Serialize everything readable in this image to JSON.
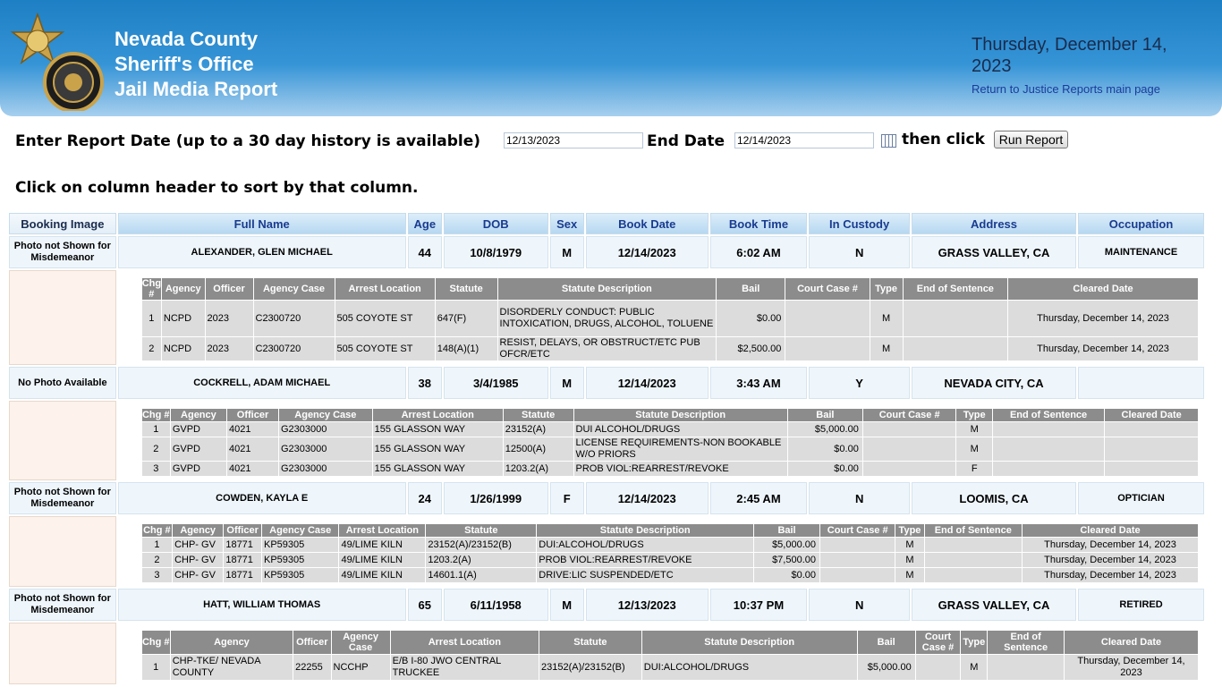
{
  "header": {
    "org_lines": [
      "Nevada County",
      "Sheriff's Office",
      "Jail Media Report"
    ],
    "date_text": "Thursday, December 14, 2023",
    "return_link": "Return to Justice Reports main page",
    "logo_icon": "sheriff-badge-seal"
  },
  "filter": {
    "report_date_label": "Enter Report Date (up to a 30 day history is available)",
    "start_date_value": "12/13/2023",
    "end_date_label": "End Date",
    "end_date_value": "12/14/2023",
    "then_click": "then click",
    "run_button": "Run Report",
    "calendar_icon": "calendar-icon"
  },
  "sort_hint": "Click on column header to sort by that column.",
  "columns": [
    "Booking Image",
    "Full Name",
    "Age",
    "DOB",
    "Sex",
    "Book Date",
    "Book Time",
    "In Custody",
    "Address",
    "Occupation"
  ],
  "bookings": [
    {
      "image": "Photo not Shown for Misdemeanor",
      "name": "ALEXANDER, GLEN MICHAEL",
      "age": "44",
      "dob": "10/8/1979",
      "sex": "M",
      "book_date": "12/14/2023",
      "book_time": "6:02 AM",
      "custody": "N",
      "address": "GRASS VALLEY, CA",
      "occupation": "MAINTENANCE",
      "charge_headers": [
        "Chg #",
        "Agency",
        "Officer",
        "Agency Case",
        "Arrest Location",
        "Statute",
        "Statute Description",
        "Bail",
        "Court Case #",
        "Type",
        "End of Sentence",
        "Cleared Date"
      ],
      "charges": [
        [
          "1",
          "NCPD",
          "2023",
          "C2300720",
          "505 COYOTE ST",
          "647(F)",
          "DISORDERLY CONDUCT: PUBLIC INTOXICATION, DRUGS, ALCOHOL, TOLUENE",
          "$0.00",
          "",
          "M",
          "",
          "Thursday, December 14, 2023"
        ],
        [
          "2",
          "NCPD",
          "2023",
          "C2300720",
          "505 COYOTE ST",
          "148(A)(1)",
          "RESIST, DELAYS, OR OBSTRUCT/ETC PUB OFCR/ETC",
          "$2,500.00",
          "",
          "M",
          "",
          "Thursday, December 14, 2023"
        ]
      ]
    },
    {
      "image": "No Photo Available",
      "name": "COCKRELL, ADAM MICHAEL",
      "age": "38",
      "dob": "3/4/1985",
      "sex": "M",
      "book_date": "12/14/2023",
      "book_time": "3:43 AM",
      "custody": "Y",
      "address": "NEVADA CITY, CA",
      "occupation": "",
      "charge_headers": [
        "Chg #",
        "Agency",
        "Officer",
        "Agency Case",
        "Arrest Location",
        "Statute",
        "Statute Description",
        "Bail",
        "Court Case #",
        "Type",
        "End of Sentence",
        "Cleared Date"
      ],
      "charges": [
        [
          "1",
          "GVPD",
          "4021",
          "G2303000",
          "155 GLASSON WAY",
          "23152(A)",
          "DUI ALCOHOL/DRUGS",
          "$5,000.00",
          "",
          "M",
          "",
          ""
        ],
        [
          "2",
          "GVPD",
          "4021",
          "G2303000",
          "155 GLASSON WAY",
          "12500(A)",
          "LICENSE REQUIREMENTS-NON BOOKABLE W/O PRIORS",
          "$0.00",
          "",
          "M",
          "",
          ""
        ],
        [
          "3",
          "GVPD",
          "4021",
          "G2303000",
          "155 GLASSON WAY",
          "1203.2(A)",
          "PROB VIOL:REARREST/REVOKE",
          "$0.00",
          "",
          "F",
          "",
          ""
        ]
      ]
    },
    {
      "image": "Photo not Shown for Misdemeanor",
      "name": "COWDEN, KAYLA E",
      "age": "24",
      "dob": "1/26/1999",
      "sex": "F",
      "book_date": "12/14/2023",
      "book_time": "2:45 AM",
      "custody": "N",
      "address": "LOOMIS, CA",
      "occupation": "OPTICIAN",
      "charge_headers": [
        "Chg #",
        "Agency",
        "Officer",
        "Agency Case",
        "Arrest Location",
        "Statute",
        "Statute Description",
        "Bail",
        "Court Case #",
        "Type",
        "End of Sentence",
        "Cleared Date"
      ],
      "charges": [
        [
          "1",
          "CHP- GV",
          "18771",
          "KP59305",
          "49/LIME KILN",
          "23152(A)/23152(B)",
          "DUI:ALCOHOL/DRUGS",
          "$5,000.00",
          "",
          "M",
          "",
          "Thursday, December 14, 2023"
        ],
        [
          "2",
          "CHP- GV",
          "18771",
          "KP59305",
          "49/LIME KILN",
          "1203.2(A)",
          "PROB VIOL:REARREST/REVOKE",
          "$7,500.00",
          "",
          "M",
          "",
          "Thursday, December 14, 2023"
        ],
        [
          "3",
          "CHP- GV",
          "18771",
          "KP59305",
          "49/LIME KILN",
          "14601.1(A)",
          "DRIVE:LIC SUSPENDED/ETC",
          "$0.00",
          "",
          "M",
          "",
          "Thursday, December 14, 2023"
        ]
      ]
    },
    {
      "image": "Photo not Shown for Misdemeanor",
      "name": "HATT, WILLIAM THOMAS",
      "age": "65",
      "dob": "6/11/1958",
      "sex": "M",
      "book_date": "12/13/2023",
      "book_time": "10:37 PM",
      "custody": "N",
      "address": "GRASS VALLEY, CA",
      "occupation": "RETIRED",
      "charge_headers": [
        "Chg #",
        "Agency",
        "Officer",
        "Agency Case",
        "Arrest Location",
        "Statute",
        "Statute Description",
        "Bail",
        "Court Case #",
        "Type",
        "End of Sentence",
        "Cleared Date"
      ],
      "charges": [
        [
          "1",
          "CHP-TKE/ NEVADA COUNTY",
          "22255",
          "NCCHP",
          "E/B I-80 JWO CENTRAL TRUCKEE",
          "23152(A)/23152(B)",
          "DUI:ALCOHOL/DRUGS",
          "$5,000.00",
          "",
          "M",
          "",
          "Thursday, December 14, 2023"
        ]
      ]
    }
  ]
}
